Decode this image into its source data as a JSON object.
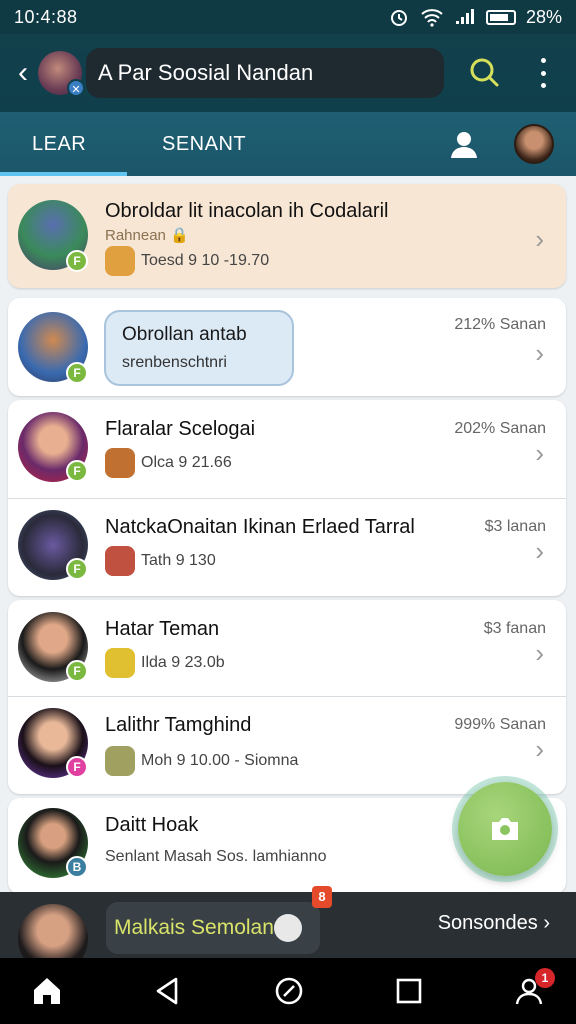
{
  "status_bar": {
    "time": "10:4:88",
    "battery": "28%"
  },
  "app_bar": {
    "title": "A Par Soosial Nandan"
  },
  "tabs": [
    {
      "label": "LEAR",
      "active": true
    },
    {
      "label": "SENANT",
      "active": false
    }
  ],
  "chats": [
    {
      "name": "Obroldar lit inacolan ih Codalaril",
      "subtitle_top": "Rahnean 🔒",
      "subtitle": "Toesd 9 10 -19.70",
      "meta": "",
      "badge": "F",
      "pinned": true
    },
    {
      "bubble_title": "Obrollan antab",
      "bubble_sub": "srenbenschtnri",
      "meta": "212% Sanan",
      "badge": "F"
    },
    {
      "name": "Flaralar Scelogai",
      "subtitle": "Olca 9 21.66",
      "meta": "202% Sanan",
      "badge": "F"
    },
    {
      "name": "NatckaOnaitan Ikinan Erlaed Tarral",
      "subtitle": "Tath 9 130",
      "meta": "$3 lanan",
      "badge": "F"
    },
    {
      "name": "Hatar Teman",
      "subtitle": "Ilda 9 23.0b",
      "meta": "$3 fanan",
      "badge": "F"
    },
    {
      "name": "Lalithr Tamghind",
      "subtitle": "Moh 9 10.00 - Siomna",
      "meta": "999% Sanan",
      "badge": "F"
    },
    {
      "name": "Daitt Hoak",
      "subtitle": "Senlant Masah Sos. lamhianno",
      "meta": "",
      "badge": "B"
    }
  ],
  "now_bar": {
    "title": "Malkais Semolan",
    "count": "8",
    "right_label": "Sonsondes"
  },
  "nav": {
    "notification_count": "1"
  },
  "colors": {
    "appbar": "#12414c",
    "tabbar": "#1f5f73",
    "accent": "#5fc4f0",
    "fab": "#8bc560",
    "badge_green": "#7bb83f"
  }
}
